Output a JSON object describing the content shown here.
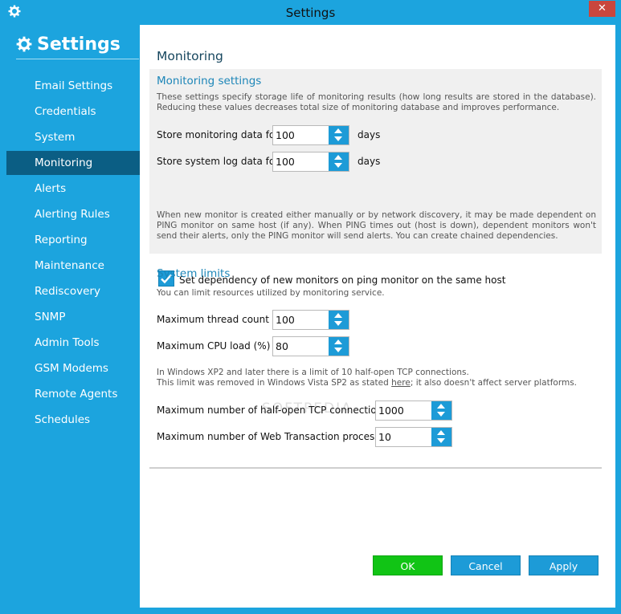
{
  "window": {
    "title": "Settings",
    "close_glyph": "✕",
    "icon": "gear-icon"
  },
  "sidebar": {
    "title": "Settings",
    "icon": "gear-icon",
    "items": [
      {
        "label": "Email Settings",
        "active": false
      },
      {
        "label": "Credentials",
        "active": false
      },
      {
        "label": "System",
        "active": false
      },
      {
        "label": "Monitoring",
        "active": true
      },
      {
        "label": "Alerts",
        "active": false
      },
      {
        "label": "Alerting Rules",
        "active": false
      },
      {
        "label": "Reporting",
        "active": false
      },
      {
        "label": "Maintenance",
        "active": false
      },
      {
        "label": "Rediscovery",
        "active": false
      },
      {
        "label": "SNMP",
        "active": false
      },
      {
        "label": "Admin Tools",
        "active": false
      },
      {
        "label": "GSM Modems",
        "active": false
      },
      {
        "label": "Remote Agents",
        "active": false
      },
      {
        "label": "Schedules",
        "active": false
      }
    ]
  },
  "main": {
    "title": "Monitoring",
    "monitoring": {
      "title": "Monitoring settings",
      "description": "These settings specify storage life of monitoring results (how long results are stored in the database). Reducing these values decreases total size of monitoring database and improves performance.",
      "store_monitoring_label": "Store monitoring data for",
      "store_monitoring_value": "100",
      "store_monitoring_unit": "days",
      "store_syslog_label": "Store system log data for",
      "store_syslog_value": "100",
      "store_syslog_unit": "days",
      "dependency_description": "When new monitor is created either manually or by network discovery, it may be made dependent on PING monitor on same host (if any). When PING times out (host is down), dependent monitors won't send their alerts, only the PING monitor will send alerts. You can create chained dependencies.",
      "dependency_checkbox_label": "Set dependency of new monitors on ping monitor on the same host",
      "dependency_checked": true
    },
    "limits": {
      "title": "System limits",
      "description": "You can limit resources utilized by monitoring service.",
      "thread_label": "Maximum thread count",
      "thread_value": "100",
      "cpu_label": "Maximum CPU load (%)",
      "cpu_value": "80",
      "tcp_note_line1": "In Windows XP2 and later there is a limit of 10 half-open TCP connections.",
      "tcp_note_line2_pre": "This limit was removed in Windows Vista SP2 as stated ",
      "tcp_note_link": "here",
      "tcp_note_line2_post": "; it also doesn't affect server platforms.",
      "halfopen_label": "Maximum number of half-open TCP connections",
      "halfopen_value": "1000",
      "web_label": "Maximum number of Web Transaction processes",
      "web_value": "10"
    }
  },
  "buttons": {
    "ok": "OK",
    "cancel": "Cancel",
    "apply": "Apply"
  },
  "watermark": "SOFTPEDIA",
  "colors": {
    "accent": "#1ca4de",
    "active_nav": "#0b5e84",
    "ok_green": "#11c415",
    "close_red": "#c9463d"
  }
}
